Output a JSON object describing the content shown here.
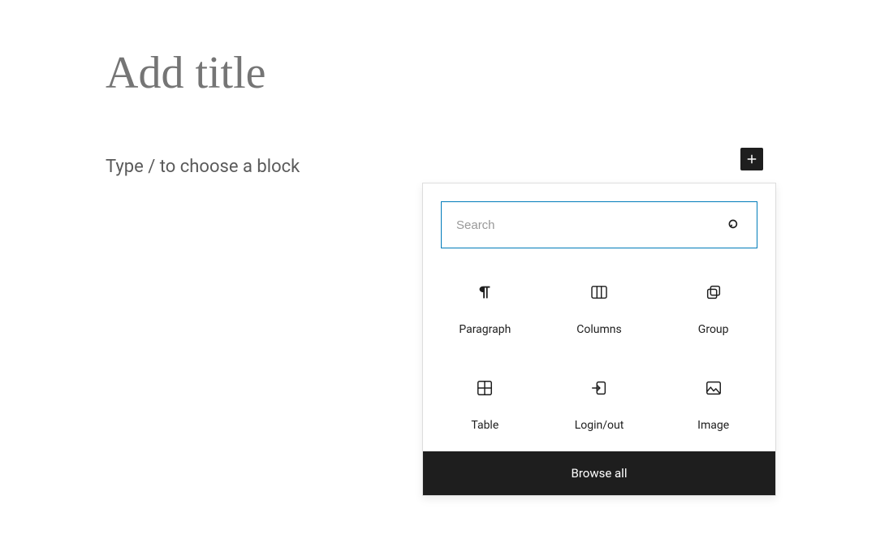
{
  "editor": {
    "title_placeholder": "Add title",
    "block_prompt": "Type / to choose a block"
  },
  "inserter": {
    "search_placeholder": "Search",
    "browse_all_label": "Browse all",
    "blocks": [
      {
        "label": "Paragraph",
        "icon": "paragraph-icon"
      },
      {
        "label": "Columns",
        "icon": "columns-icon"
      },
      {
        "label": "Group",
        "icon": "group-icon"
      },
      {
        "label": "Table",
        "icon": "table-icon"
      },
      {
        "label": "Login/out",
        "icon": "login-out-icon"
      },
      {
        "label": "Image",
        "icon": "image-icon"
      }
    ]
  },
  "colors": {
    "accent": "#007cba",
    "dark": "#1e1e1e"
  }
}
